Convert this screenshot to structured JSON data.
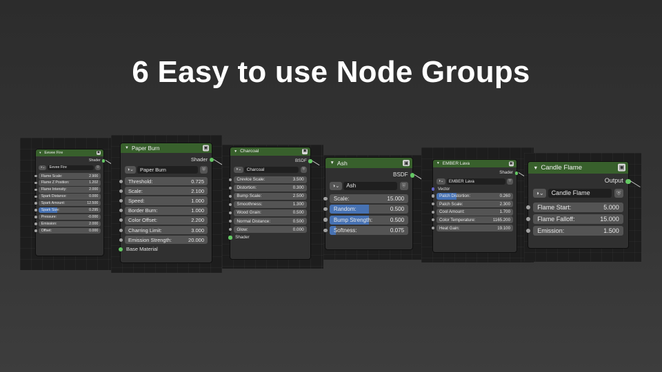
{
  "headline": "6 Easy to use Node Groups",
  "nodes": [
    {
      "title": "Eevee Fire",
      "output": "Shader",
      "group_name": "Eevee Fire",
      "fields": [
        {
          "label": "Flame Scale:",
          "value": "2.900"
        },
        {
          "label": "Flame Z Position:",
          "value": "1.202"
        },
        {
          "label": "Flame Intensity:",
          "value": "2.000"
        },
        {
          "label": "Spark Distance:",
          "value": "0.000"
        },
        {
          "label": "Spark Amount:",
          "value": "12.500"
        },
        {
          "label": "Spark Size:",
          "value": "0.295",
          "fill": 0.295
        },
        {
          "label": "Pressure:",
          "value": "-0.000"
        },
        {
          "label": "Emission:",
          "value": "2.000"
        },
        {
          "label": "Offset:",
          "value": "0.000"
        }
      ]
    },
    {
      "title": "Paper Burn",
      "output": "Shader",
      "group_name": "Paper Burn",
      "fields": [
        {
          "label": "Threshold:",
          "value": "0.725"
        },
        {
          "label": "Scale:",
          "value": "2.100"
        },
        {
          "label": "Speed:",
          "value": "1.000"
        },
        {
          "label": "Border Burn:",
          "value": "1.000"
        },
        {
          "label": "Color Offset:",
          "value": "2.200"
        },
        {
          "label": "Charring Limit:",
          "value": "3.000"
        },
        {
          "label": "Emission Strength:",
          "value": "20.000"
        }
      ],
      "extra_input": "Base Material"
    },
    {
      "title": "Charcoal",
      "output": "BSDF",
      "group_name": "Charcoal",
      "fields": [
        {
          "label": "Crevice Scale:",
          "value": "3.500"
        },
        {
          "label": "Distortion:",
          "value": "0.300"
        },
        {
          "label": "Bump Scale:",
          "value": "2.500"
        },
        {
          "label": "Smoothness:",
          "value": "1.300"
        },
        {
          "label": "Wood Grain:",
          "value": "0.500"
        },
        {
          "label": "Normal Distance:",
          "value": "0.500"
        },
        {
          "label": "Glow:",
          "value": "0.000"
        }
      ],
      "extra_input": "Shader"
    },
    {
      "title": "Ash",
      "output": "BSDF",
      "group_name": "Ash",
      "fields": [
        {
          "label": "Scale:",
          "value": "15.000"
        },
        {
          "label": "Random:",
          "value": "0.500",
          "fill": 0.5
        },
        {
          "label": "Bump Strength:",
          "value": "0.500",
          "fill": 0.5
        },
        {
          "label": "Softness:",
          "value": "0.075",
          "fill": 0.075
        }
      ]
    },
    {
      "title": "EMBER Lava",
      "output": "Shader",
      "group_name": "EMBER Lava",
      "vector_input": "Vector",
      "fields": [
        {
          "label": "Patch Distortion:",
          "value": "0.260",
          "fill": 0.26
        },
        {
          "label": "Patch Scale:",
          "value": "2.300"
        },
        {
          "label": "Cool Amount:",
          "value": "1.700"
        },
        {
          "label": "Color Temperature:",
          "value": "1165.200"
        },
        {
          "label": "Heat Gain:",
          "value": "19.100"
        }
      ]
    },
    {
      "title": "Candle Flame",
      "output": "Output",
      "group_name": "Candle Flame",
      "fields": [
        {
          "label": "Flame Start:",
          "value": "5.000"
        },
        {
          "label": "Flame Falloff:",
          "value": "15.000"
        },
        {
          "label": "Emission:",
          "value": "1.500"
        }
      ]
    }
  ]
}
